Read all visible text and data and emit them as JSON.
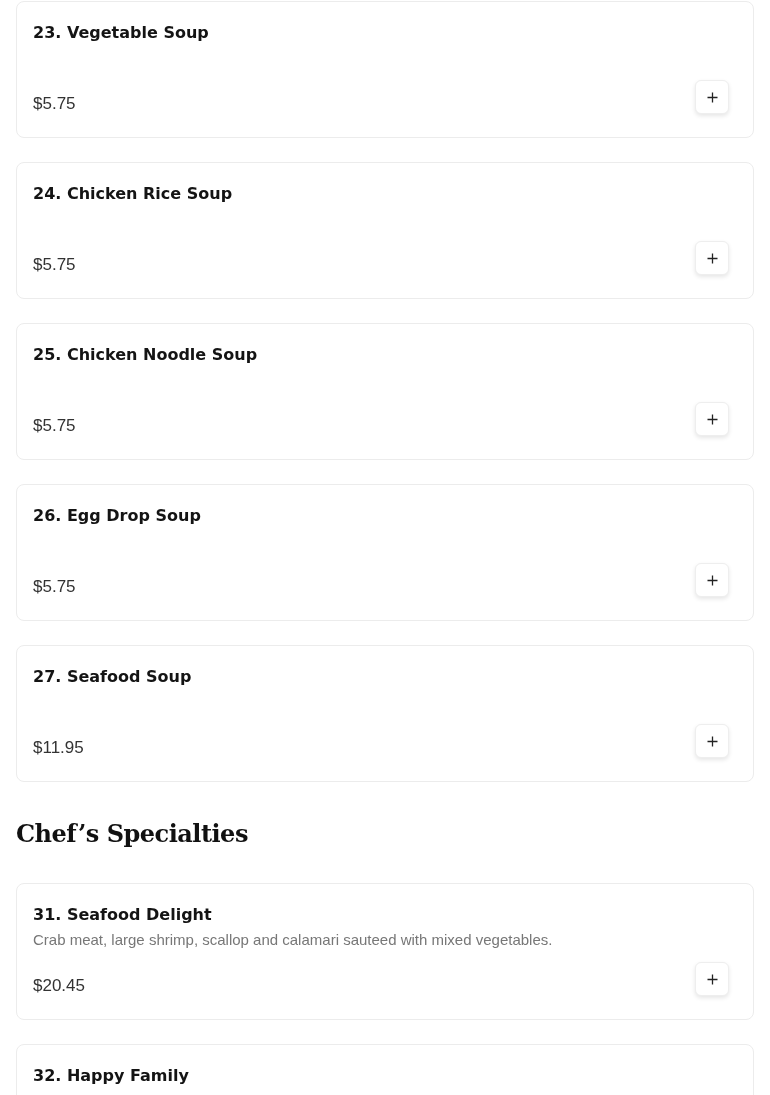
{
  "sections": [
    {
      "items": [
        {
          "name": "23. Vegetable Soup",
          "price": "$5.75"
        },
        {
          "name": "24. Chicken Rice Soup",
          "price": "$5.75"
        },
        {
          "name": "25. Chicken Noodle Soup",
          "price": "$5.75"
        },
        {
          "name": "26. Egg Drop Soup",
          "price": "$5.75"
        },
        {
          "name": "27. Seafood Soup",
          "price": "$11.95"
        }
      ]
    },
    {
      "title": "Chef’s Specialties",
      "items": [
        {
          "name": "31. Seafood Delight",
          "description": "Crab meat, large shrimp, scallop and calamari sauteed with mixed vegetables.",
          "price": "$20.45"
        },
        {
          "name": "32. Happy Family"
        }
      ]
    }
  ]
}
